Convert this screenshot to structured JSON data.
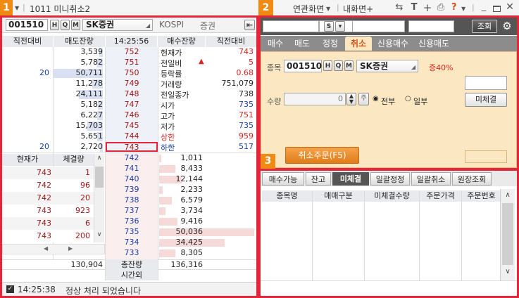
{
  "title": {
    "badge": "1",
    "screen_name": "1011 미니취소2",
    "menu_links": "연관화면",
    "menu_my": "내화면+",
    "help_icon": "?"
  },
  "left": {
    "stock_code": "001510",
    "stock_name": "SK증권",
    "market": "KOSPI",
    "sector": "증권",
    "headers": {
      "prev_diff": "직전대비",
      "sell_qty": "매도잔량",
      "time": "14:25:56",
      "buy_qty": "매수잔량",
      "prev_diff2": "직전대비"
    },
    "asks": [
      {
        "diff": "",
        "qty": "3,539",
        "price": "752"
      },
      {
        "diff": "",
        "qty": "5,782",
        "price": "751"
      },
      {
        "diff": "20",
        "qty": "50,711",
        "price": "750"
      },
      {
        "diff": "",
        "qty": "11,278",
        "price": "749"
      },
      {
        "diff": "",
        "qty": "24,111",
        "price": "748"
      },
      {
        "diff": "",
        "qty": "5,182",
        "price": "747"
      },
      {
        "diff": "",
        "qty": "6,227",
        "price": "746"
      },
      {
        "diff": "",
        "qty": "15,703",
        "price": "745"
      },
      {
        "diff": "",
        "qty": "5,651",
        "price": "744"
      },
      {
        "diff": "20",
        "qty": "2,720",
        "price": "743"
      }
    ],
    "ask_bar_fracs": [
      0.07,
      0.11,
      1.0,
      0.22,
      0.48,
      0.1,
      0.12,
      0.31,
      0.11,
      0.05
    ],
    "info": [
      {
        "label": "현재가",
        "value": "743"
      },
      {
        "label": "전일비",
        "value": "5"
      },
      {
        "label": "등락률",
        "value": "0.68"
      },
      {
        "label": "거래량",
        "value": "751,079"
      },
      {
        "label": "전일종가",
        "value": "738"
      },
      {
        "label": "시가",
        "value": "735"
      },
      {
        "label": "고가",
        "value": "751"
      },
      {
        "label": "저가",
        "value": "735"
      },
      {
        "label": "상한",
        "value": "959"
      },
      {
        "label": "하한",
        "value": "517"
      }
    ],
    "trade_headers": {
      "price": "현재가",
      "volume": "체결량"
    },
    "trades": [
      {
        "price": "743",
        "volume": "1"
      },
      {
        "price": "742",
        "volume": "96"
      },
      {
        "price": "742",
        "volume": "20"
      },
      {
        "price": "743",
        "volume": "923"
      },
      {
        "price": "743",
        "volume": "6"
      },
      {
        "price": "743",
        "volume": "200"
      }
    ],
    "bids": [
      {
        "price": "742",
        "qty": "1,011"
      },
      {
        "price": "741",
        "qty": "8,433"
      },
      {
        "price": "740",
        "qty": "12,144"
      },
      {
        "price": "739",
        "qty": "2,233"
      },
      {
        "price": "738",
        "qty": "6,579"
      },
      {
        "price": "737",
        "qty": "3,734"
      },
      {
        "price": "736",
        "qty": "9,416"
      },
      {
        "price": "735",
        "qty": "50,036"
      },
      {
        "price": "734",
        "qty": "34,425"
      },
      {
        "price": "733",
        "qty": "8,305"
      }
    ],
    "bid_bar_fracs": [
      0.02,
      0.17,
      0.24,
      0.04,
      0.13,
      0.07,
      0.19,
      1.0,
      0.69,
      0.17
    ],
    "total_sell": "130,904",
    "total_label": "총잔량",
    "total_buy": "136,316",
    "after_hours": "시간외"
  },
  "order": {
    "badge": "2",
    "inquiry_button": "조회",
    "tabs": [
      "매수",
      "매도",
      "정정",
      "취소",
      "신용매수",
      "신용매도"
    ],
    "active_tab": "취소",
    "stock_label": "종목",
    "stock_code": "001510",
    "stock_name": "SK증권",
    "margin": "증40%",
    "qty_label": "수량",
    "qty_value": "0",
    "radio_all": "전부",
    "radio_part": "일부",
    "unfilled_button": "미체결",
    "cancel_button": "취소주문(F5)"
  },
  "lower": {
    "badge": "3",
    "tabs": [
      "매수가능",
      "잔고",
      "미체결",
      "일괄정정",
      "일괄취소",
      "원장조회"
    ],
    "active_tab": "미체결",
    "columns": [
      "종목명",
      "매매구분",
      "미체결수량",
      "주문가격",
      "주문번호"
    ]
  },
  "status": {
    "time": "14:25:38",
    "message": "정상 처리 되었습니다"
  }
}
